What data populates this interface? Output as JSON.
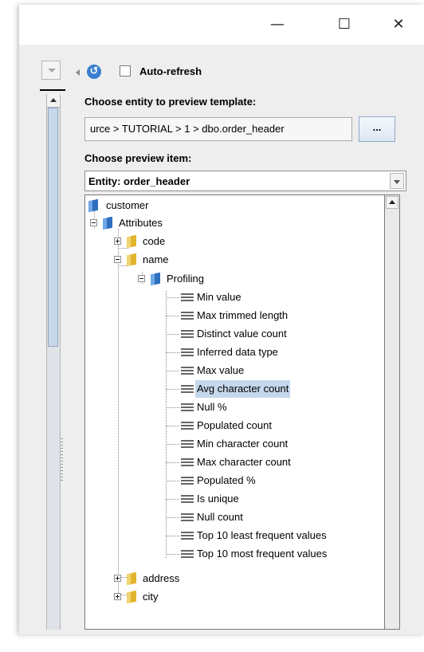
{
  "window": {
    "minimize_glyph": "—",
    "maximize_glyph": "☐",
    "close_glyph": "✕"
  },
  "toolbar": {
    "refresh_glyph": "↺",
    "auto_refresh_label": "Auto-refresh",
    "auto_refresh_checked": false
  },
  "entity": {
    "label": "Choose entity to preview template:",
    "path_value": "urce > TUTORIAL > 1 > dbo.order_header",
    "browse_label": "..."
  },
  "preview": {
    "label": "Choose preview item:",
    "selected": "Entity: order_header"
  },
  "tree": {
    "root": "customer",
    "attributes": "Attributes",
    "code": "code",
    "name": "name",
    "profiling": "Profiling",
    "profiling_items": [
      "Min value",
      "Max trimmed length",
      "Distinct value count",
      "Inferred data type",
      "Max value",
      "Avg character count",
      "Null %",
      "Populated count",
      "Min character count",
      "Max character count",
      "Populated %",
      "Is unique",
      "Null count",
      "Top 10 least frequent values",
      "Top 10 most frequent values"
    ],
    "selected_item": "Avg character count",
    "address": "address",
    "city": "city"
  },
  "colors": {
    "selection": "#c5d7ec",
    "accent": "#3a7fd0"
  }
}
